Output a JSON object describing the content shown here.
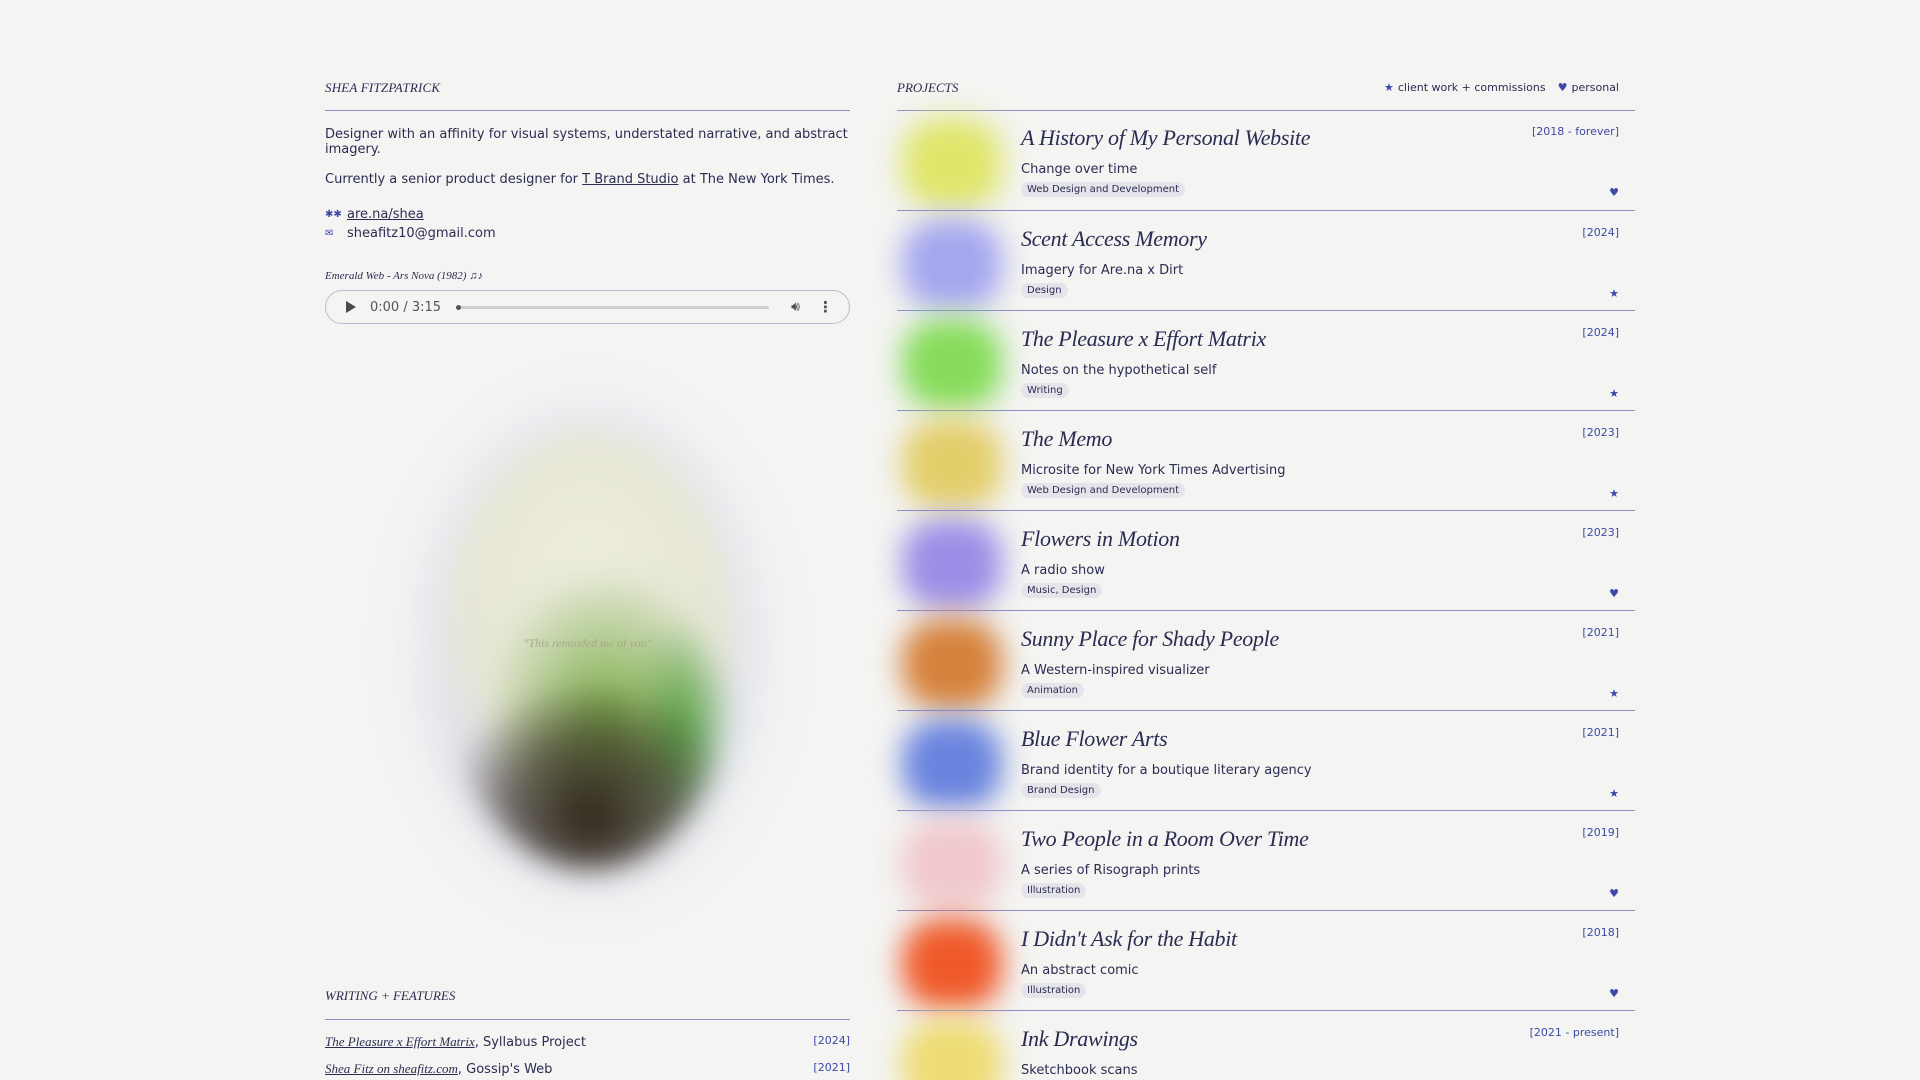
{
  "profile": {
    "name": "SHEA FITZPATRICK",
    "bio": "Designer with an affinity for visual systems, understated narrative, and abstract imagery.",
    "current_prefix": "Currently a senior product designer for ",
    "current_link": "T Brand Studio",
    "current_suffix": " at The New York Times.",
    "arena_icon": "arena-icon",
    "arena_link": "are.na/shea",
    "email_icon": "mail-icon",
    "email": "sheafitz10@gmail.com"
  },
  "player": {
    "song": "Emerald Web - Ars Nova (1982) ♫♪",
    "time": "0:00 / 3:15",
    "progress": 0
  },
  "image": {
    "caption": "\"This reminded me of you\""
  },
  "writing": {
    "heading": "WRITING + FEATURES",
    "items": [
      {
        "link": "The Pleasure x Effort Matrix",
        "rest": ", Syllabus Project",
        "year": "[2024]"
      },
      {
        "link": "Shea Fitz on sheafitz.com",
        "rest": ", Gossip's Web",
        "year": "[2021]"
      }
    ]
  },
  "projects_section": {
    "heading": "PROJECTS",
    "legend_client": "client work + commissions",
    "legend_personal": "personal"
  },
  "projects": [
    {
      "title": "A History of My Personal Website",
      "subtitle": "Change over time",
      "tag": "Web Design and Development",
      "year": "[2018 - forever]",
      "kind": "personal",
      "color": "#dfe66a"
    },
    {
      "title": "Scent Access Memory",
      "subtitle": "Imagery for Are.na x Dirt",
      "tag": "Design",
      "year": "[2024]",
      "kind": "client",
      "color": "#a4a6ee"
    },
    {
      "title": "The Pleasure x Effort Matrix",
      "subtitle": "Notes on the hypothetical self",
      "tag": "Writing",
      "year": "[2024]",
      "kind": "client",
      "color": "#86dc5a"
    },
    {
      "title": "The Memo",
      "subtitle": "Microsite for New York Times Advertising",
      "tag": "Web Design and Development",
      "year": "[2023]",
      "kind": "client",
      "color": "#e3ce6a"
    },
    {
      "title": "Flowers in Motion",
      "subtitle": "A radio show",
      "tag": "Music, Design",
      "year": "[2023]",
      "kind": "personal",
      "color": "#9b8ee6"
    },
    {
      "title": "Sunny Place for Shady People",
      "subtitle": "A Western-inspired visualizer",
      "tag": "Animation",
      "year": "[2021]",
      "kind": "client",
      "color": "#d6823c"
    },
    {
      "title": "Blue Flower Arts",
      "subtitle": "Brand identity for a boutique literary agency",
      "tag": "Brand Design",
      "year": "[2021]",
      "kind": "client",
      "color": "#6a84de"
    },
    {
      "title": "Two People in a Room Over Time",
      "subtitle": "A series of Risograph prints",
      "tag": "Illustration",
      "year": "[2019]",
      "kind": "personal",
      "color": "#f0c8cc"
    },
    {
      "title": "I Didn't Ask for the Habit",
      "subtitle": "An abstract comic",
      "tag": "Illustration",
      "year": "[2018]",
      "kind": "personal",
      "color": "#ef5a2a"
    },
    {
      "title": "Ink Drawings",
      "subtitle": "Sketchbook scans",
      "tag": "",
      "year": "[2021 - present]",
      "kind": "",
      "color": "#eedc74"
    }
  ]
}
